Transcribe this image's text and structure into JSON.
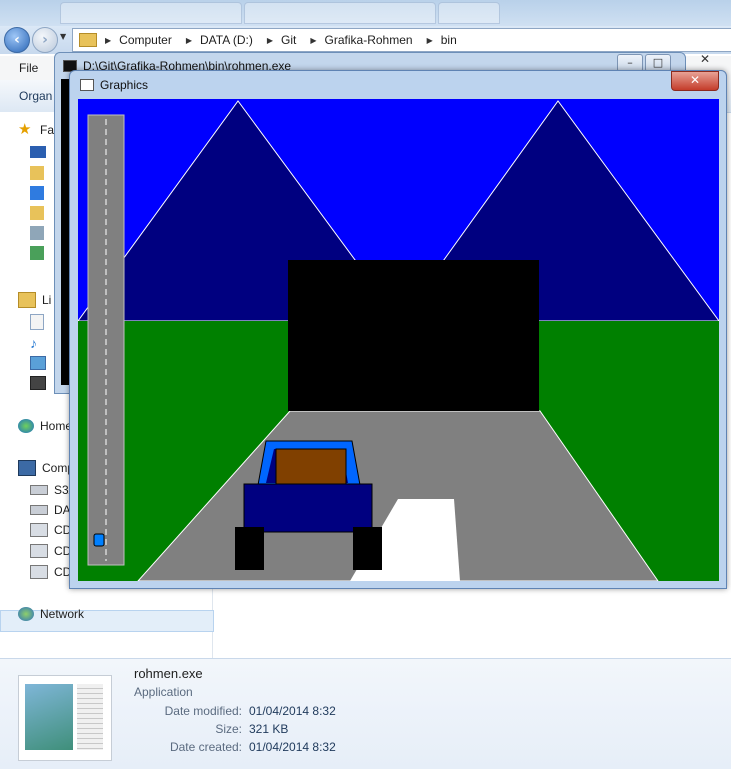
{
  "explorer": {
    "breadcrumb": [
      "Computer",
      "DATA (D:)",
      "Git",
      "Grafika-Rohmen",
      "bin"
    ],
    "menu_file": "File",
    "cmd_organize": "Organ",
    "nav_items": [
      "Fa",
      "Li",
      "Home",
      "Comp",
      "S3A",
      "DAT",
      "CD",
      "CD",
      "CD",
      "Network"
    ]
  },
  "console_window": {
    "title": "D:\\Git\\Grafika-Rohmen\\bin\\rohmen.exe"
  },
  "graphics_window": {
    "title": "Graphics",
    "close_glyph": "✕"
  },
  "scene_colors": {
    "sky": "#0000ff",
    "mountains": "#000080",
    "grass": "#008000",
    "road": "#808080",
    "tunnel": "#000000",
    "car_body": "#000080",
    "car_roof": "#0066ff",
    "car_cargo": "#804000",
    "lane_marker": "#ffffff",
    "minimap_car": "#0080ff"
  },
  "details": {
    "filename": "rohmen.exe",
    "type": "Application",
    "rows": [
      {
        "label": "Date modified:",
        "value": "01/04/2014 8:32"
      },
      {
        "label": "Size:",
        "value": "321 KB"
      },
      {
        "label": "Date created:",
        "value": "01/04/2014 8:32"
      }
    ]
  }
}
